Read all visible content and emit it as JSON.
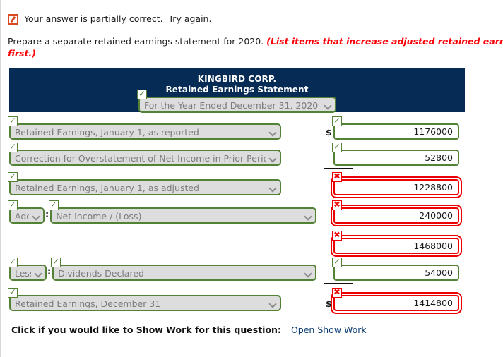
{
  "feedback": {
    "icon": "partial-credit-icon",
    "text": "Your answer is partially correct.  Try again."
  },
  "instruction": {
    "main": "Prepare a separate retained earnings statement for 2020. ",
    "hint": "(List items that increase adjusted retained earnings first.)"
  },
  "statement": {
    "company": "KINGBIRD CORP.",
    "title": "Retained Earnings Statement",
    "period_select": {
      "value": "For the Year Ended December 31, 2020",
      "status": "correct"
    }
  },
  "rows": [
    {
      "label_select": {
        "value": "Retained Earnings, January 1, as reported",
        "status": "correct"
      },
      "amount": {
        "value": "1176000",
        "status": "correct",
        "dollar": true,
        "rule": "none"
      }
    },
    {
      "label_select": {
        "value": "Correction for Overstatement of Net Income in Prior Period",
        "status": "correct"
      },
      "amount": {
        "value": "52800",
        "status": "correct",
        "dollar": false,
        "rule": "single"
      }
    },
    {
      "label_select": {
        "value": "Retained Earnings, January 1, as adjusted",
        "status": "correct"
      },
      "amount": {
        "value": "1228800",
        "status": "incorrect",
        "dollar": false,
        "rule": "none"
      }
    },
    {
      "prefix_select": {
        "value": "Add",
        "status": "correct"
      },
      "label_select": {
        "value": "Net Income / (Loss)",
        "status": "correct"
      },
      "amount": {
        "value": "240000",
        "status": "incorrect",
        "dollar": false,
        "rule": "single"
      }
    },
    {
      "amount": {
        "value": "1468000",
        "status": "incorrect",
        "dollar": false,
        "rule": "none"
      }
    },
    {
      "prefix_select": {
        "value": "Less",
        "status": "correct"
      },
      "label_select": {
        "value": "Dividends Declared",
        "status": "correct"
      },
      "amount": {
        "value": "54000",
        "status": "correct",
        "dollar": false,
        "rule": "single"
      }
    },
    {
      "label_select": {
        "value": "Retained Earnings, December 31",
        "status": "correct"
      },
      "amount": {
        "value": "1414800",
        "status": "incorrect",
        "dollar": true,
        "rule": "double"
      }
    }
  ],
  "footer": {
    "prompt": "Click if you would like to Show Work for this question:",
    "link": "Open Show Work"
  },
  "glyphs": {
    "check": "✓",
    "cross": "✖"
  },
  "colors": {
    "navy": "#062b54",
    "green": "#538135",
    "red": "#ee0000",
    "hint_red": "#fb0007",
    "link": "#0b3d73",
    "partial": "#d94a20"
  }
}
